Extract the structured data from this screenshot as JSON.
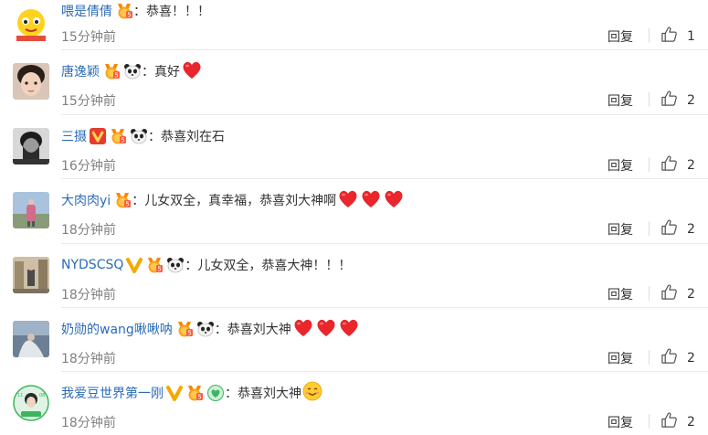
{
  "labels": {
    "reply": "回复",
    "separator": "："
  },
  "comments": [
    {
      "user": "喂是倩倩",
      "badges": [
        "medal-icon"
      ],
      "text": "恭喜！！！",
      "hearts": 0,
      "time": "15分钟前",
      "likes": "1",
      "avatar": "yellow-cartoon-avatar"
    },
    {
      "user": "唐逸颖",
      "badges": [
        "medal-icon",
        "panda-icon"
      ],
      "text": "真好",
      "hearts": 1,
      "time": "15分钟前",
      "likes": "2",
      "avatar": "child-photo-avatar"
    },
    {
      "user": "三摄",
      "badges": [
        "verified-v-red-icon",
        "medal-icon",
        "panda-icon"
      ],
      "text": "恭喜刘在石",
      "hearts": 0,
      "time": "16分钟前",
      "likes": "2",
      "avatar": "man-photo-avatar"
    },
    {
      "user": "大肉肉yi",
      "badges": [
        "medal-icon"
      ],
      "text": "儿女双全，真幸福，恭喜刘大神啊",
      "hearts": 3,
      "time": "18分钟前",
      "likes": "2",
      "avatar": "outdoor-photo-avatar"
    },
    {
      "user": "NYDSCSQ",
      "badges": [
        "verified-v-gold-icon",
        "medal-icon",
        "panda-icon"
      ],
      "text": "儿女双全，恭喜大神！！！",
      "hearts": 0,
      "time": "18分钟前",
      "likes": "2",
      "avatar": "street-photo-avatar"
    },
    {
      "user": "奶勋的wang啾啾呐",
      "badges": [
        "medal-icon",
        "panda-icon"
      ],
      "text": "恭喜刘大神",
      "hearts": 3,
      "time": "18分钟前",
      "likes": "2",
      "avatar": "blue-photo-avatar"
    },
    {
      "user": "我爱豆世界第一刚",
      "badges": [
        "verified-v-gold-icon",
        "medal-icon",
        "green-heart-icon"
      ],
      "text": "恭喜刘大神",
      "hearts": 0,
      "emoji": "smiling-face-icon",
      "time": "18分钟前",
      "likes": "2",
      "avatar": "green-circle-avatar"
    }
  ],
  "colors": {
    "username": "#2b6bb7",
    "time": "#808080",
    "heart": "#e8262b",
    "verified_gold": "#f2a900",
    "verified_red": "#e63b2e"
  }
}
